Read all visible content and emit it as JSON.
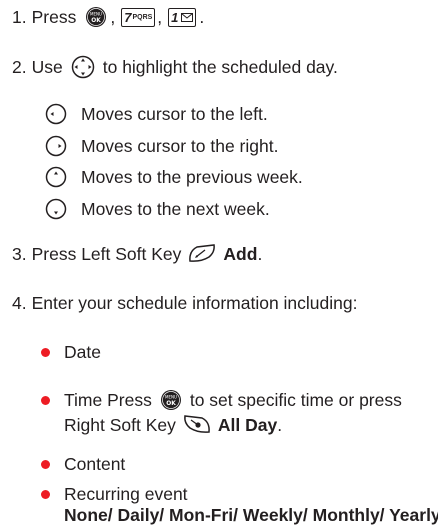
{
  "steps": [
    {
      "num": "1.",
      "text": "Press",
      "sep1": ",",
      "sep2": ",",
      "end": "."
    },
    {
      "num": "2.",
      "text_a": "Use",
      "text_b": "to highlight the scheduled day."
    },
    {
      "num": "3.",
      "text": "Press Left Soft Key",
      "bold": "Add",
      "end": "."
    },
    {
      "num": "4.",
      "text": "Enter your schedule information including:"
    }
  ],
  "keys": {
    "seven": "7",
    "seven_letters": "PQRS",
    "one": "1"
  },
  "nav_items": [
    {
      "text": "Moves cursor to the left."
    },
    {
      "text": "Moves cursor to the right."
    },
    {
      "text": "Moves to the previous week."
    },
    {
      "text": "Moves to the next week."
    }
  ],
  "bullets": {
    "date": "Date",
    "time_a": "Time Press",
    "time_b": "to set specific time or press",
    "time_c": "Right Soft Key",
    "time_bold": "All Day",
    "time_end": ".",
    "content": "Content",
    "recurring": "Recurring event",
    "recurring_options": "None/ Daily/ Mon-Fri/ Weekly/ Monthly/ Yearly"
  },
  "colors": {
    "bullet": "#ed1c24",
    "text": "#231f20"
  }
}
